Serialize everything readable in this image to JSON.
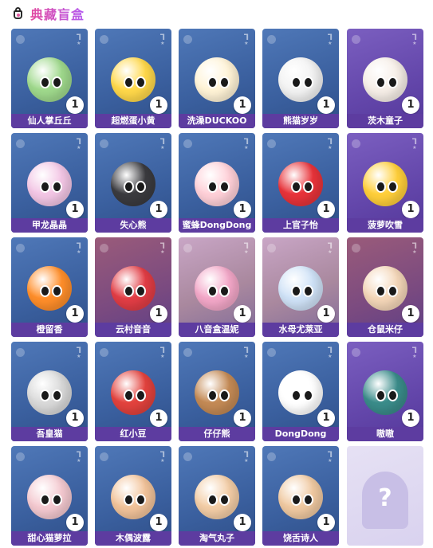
{
  "header": {
    "title": "典藏盲盒"
  },
  "cards": [
    {
      "name": "仙人掌丘丘",
      "count": "1",
      "theme": "blue",
      "color": "#9fd98c"
    },
    {
      "name": "超燃蛋小黄",
      "count": "1",
      "theme": "blue",
      "color": "#ffd84a"
    },
    {
      "name": "洗澡DUCKOO",
      "count": "1",
      "theme": "blue",
      "color": "#fff3d6"
    },
    {
      "name": "熊猫岁岁",
      "count": "1",
      "theme": "blue",
      "color": "#f2f2f2"
    },
    {
      "name": "茨木童子",
      "count": "1",
      "theme": "purple",
      "color": "#f6eee7"
    },
    {
      "name": "甲龙晶晶",
      "count": "1",
      "theme": "blue",
      "color": "#f3c6e5"
    },
    {
      "name": "失心熊",
      "count": "1",
      "theme": "blue",
      "color": "#3b3b3f"
    },
    {
      "name": "蜜蜂DongDong",
      "count": "1",
      "theme": "blue",
      "color": "#ffd0d8"
    },
    {
      "name": "上官子怡",
      "count": "1",
      "theme": "blue",
      "color": "#e8333a"
    },
    {
      "name": "菠萝吹雪",
      "count": "1",
      "theme": "purple",
      "color": "#ffcf3a"
    },
    {
      "name": "橙留香",
      "count": "1",
      "theme": "blue",
      "color": "#ff8e2a"
    },
    {
      "name": "云村音音",
      "count": "1",
      "theme": "red",
      "color": "#e23d45"
    },
    {
      "name": "八音盒温妮",
      "count": "1",
      "theme": "pinkish",
      "color": "#f3a7c8"
    },
    {
      "name": "水母尤莱亚",
      "count": "1",
      "theme": "pinkish",
      "color": "#cfe2f7"
    },
    {
      "name": "仓鼠米仔",
      "count": "1",
      "theme": "red",
      "color": "#f4d6b8"
    },
    {
      "name": "吾皇猫",
      "count": "1",
      "theme": "blue",
      "color": "#d9d9d9"
    },
    {
      "name": "红小豆",
      "count": "1",
      "theme": "blue",
      "color": "#e3423d"
    },
    {
      "name": "仔仔熊",
      "count": "1",
      "theme": "blue",
      "color": "#c48a55"
    },
    {
      "name": "DongDong",
      "count": "1",
      "theme": "blue",
      "color": "#ffffff"
    },
    {
      "name": "嗷嗷",
      "count": "1",
      "theme": "purple",
      "color": "#3a8c8a"
    },
    {
      "name": "甜心猫萝拉",
      "count": "1",
      "theme": "blue",
      "color": "#f4c9d0"
    },
    {
      "name": "木偶波露",
      "count": "1",
      "theme": "blue",
      "color": "#f2c39a"
    },
    {
      "name": "淘气丸子",
      "count": "1",
      "theme": "blue",
      "color": "#f3cda6"
    },
    {
      "name": "饶舌诗人",
      "count": "1",
      "theme": "blue",
      "color": "#f0c9a1"
    },
    {
      "name": "",
      "count": "",
      "theme": "empty",
      "color": ""
    }
  ]
}
